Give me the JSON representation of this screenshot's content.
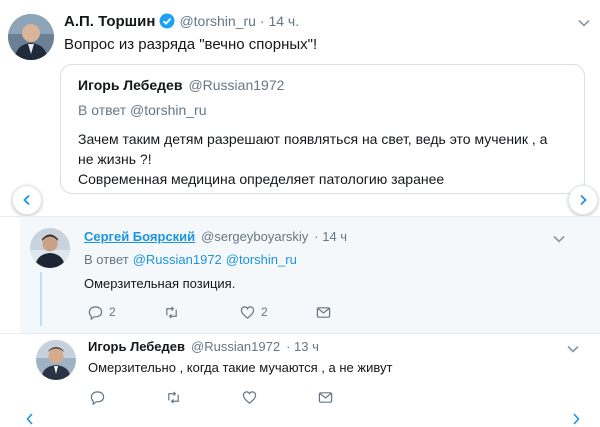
{
  "tweet1": {
    "author_name": "А.П. Торшин",
    "handle": "@torshin_ru",
    "time": "· 14 ч.",
    "text": "Вопрос из разряда \"вечно спорных\"!"
  },
  "quoted": {
    "author_name": "Игорь Лебедев",
    "handle": "@Russian1972",
    "reply_to": "В ответ @torshin_ru",
    "text_line1": "Зачем таким детям разрешают появляться на свет, ведь это мученик , а",
    "text_line2": "не жизнь ?!",
    "text_line3": "Современная медицина определяет патологию заранее"
  },
  "reply1": {
    "author_name": "Сергей Боярский",
    "handle": "@sergeyboyarskiy",
    "time": "· 14 ч",
    "reply_prefix": "В ответ",
    "reply_mention1": "@Russian1972",
    "reply_mention2": "@torshin_ru",
    "text": "Омерзительная позиция.",
    "reply_count": "2",
    "retweet_count": "",
    "like_count": "2"
  },
  "reply2": {
    "author_name": "Игорь Лебедев",
    "handle": "@Russian1972",
    "time": "· 13 ч",
    "text": "Омерзительно , когда такие мучаются , а не живут"
  },
  "colors": {
    "link": "#1b95e0",
    "verified": "#1da1f2",
    "muted": "#657786",
    "thread_line": "#b8e0f8"
  },
  "icons": [
    "verified-badge-icon",
    "chevron-down-icon",
    "chevron-left-icon",
    "chevron-right-icon",
    "reply-icon",
    "retweet-icon",
    "like-icon",
    "direct-message-icon"
  ]
}
